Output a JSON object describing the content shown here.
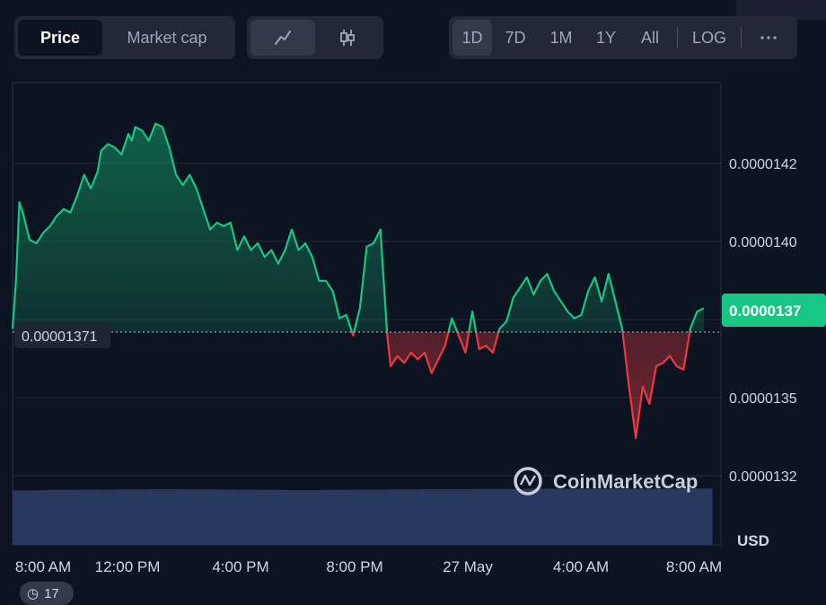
{
  "toolbar": {
    "metric_tabs": [
      {
        "label": "Price",
        "active": true
      },
      {
        "label": "Market cap",
        "active": false
      }
    ],
    "chart_type_icons": [
      "line-chart-icon",
      "candlestick-icon"
    ],
    "ranges": [
      "1D",
      "7D",
      "1M",
      "1Y",
      "All"
    ],
    "active_range": "1D",
    "log_label": "LOG",
    "more_icon": "more-horizontal-icon"
  },
  "colors": {
    "background": "#0d1421",
    "up": "#16c784",
    "down": "#ea3943",
    "volume": "#2b3a63",
    "badge": "#16c784"
  },
  "chart_data": {
    "type": "line",
    "y_tick_labels": [
      "0.0000142",
      "0.0000140",
      "0.0000137",
      "0.0000135",
      "0.0000132"
    ],
    "ylim": [
      1.315e-05,
      1.445e-05
    ],
    "x_tick_labels": [
      "8:00 AM",
      "12:00 PM",
      "4:00 PM",
      "8:00 PM",
      "27 May",
      "4:00 AM",
      "8:00 AM"
    ],
    "reference_price": 1.371e-05,
    "reference_label": "0.00001371",
    "current_price_label": "0.0000137",
    "currency_label": "USD",
    "watermark": "CoinMarketCap",
    "price": [
      [
        0.0,
        1.373e-05
      ],
      [
        0.1,
        1.387e-05
      ],
      [
        0.2,
        1.41e-05
      ],
      [
        0.3,
        1.407e-05
      ],
      [
        0.5,
        1.399e-05
      ],
      [
        0.7,
        1.398e-05
      ],
      [
        0.9,
        1.401e-05
      ],
      [
        1.1,
        1.403e-05
      ],
      [
        1.3,
        1.406e-05
      ],
      [
        1.5,
        1.408e-05
      ],
      [
        1.7,
        1.407e-05
      ],
      [
        1.9,
        1.412e-05
      ],
      [
        2.1,
        1.418e-05
      ],
      [
        2.3,
        1.414e-05
      ],
      [
        2.5,
        1.419e-05
      ],
      [
        2.6,
        1.425e-05
      ],
      [
        2.8,
        1.427e-05
      ],
      [
        3.0,
        1.426e-05
      ],
      [
        3.2,
        1.424e-05
      ],
      [
        3.4,
        1.43e-05
      ],
      [
        3.5,
        1.428e-05
      ],
      [
        3.6,
        1.432e-05
      ],
      [
        3.8,
        1.431e-05
      ],
      [
        4.0,
        1.428e-05
      ],
      [
        4.2,
        1.433e-05
      ],
      [
        4.4,
        1.432e-05
      ],
      [
        4.6,
        1.426e-05
      ],
      [
        4.8,
        1.418e-05
      ],
      [
        5.0,
        1.415e-05
      ],
      [
        5.2,
        1.418e-05
      ],
      [
        5.4,
        1.414e-05
      ],
      [
        5.6,
        1.408e-05
      ],
      [
        5.8,
        1.402e-05
      ],
      [
        6.0,
        1.404e-05
      ],
      [
        6.2,
        1.403e-05
      ],
      [
        6.4,
        1.404e-05
      ],
      [
        6.6,
        1.396e-05
      ],
      [
        6.8,
        1.4e-05
      ],
      [
        7.0,
        1.396e-05
      ],
      [
        7.2,
        1.398e-05
      ],
      [
        7.4,
        1.394e-05
      ],
      [
        7.6,
        1.396e-05
      ],
      [
        7.8,
        1.392e-05
      ],
      [
        8.0,
        1.396e-05
      ],
      [
        8.2,
        1.402e-05
      ],
      [
        8.4,
        1.396e-05
      ],
      [
        8.6,
        1.398e-05
      ],
      [
        8.8,
        1.394e-05
      ],
      [
        9.0,
        1.387e-05
      ],
      [
        9.2,
        1.387e-05
      ],
      [
        9.4,
        1.384e-05
      ],
      [
        9.6,
        1.376e-05
      ],
      [
        9.8,
        1.377e-05
      ],
      [
        10.0,
        1.371e-05
      ],
      [
        10.2,
        1.379e-05
      ],
      [
        10.4,
        1.397e-05
      ],
      [
        10.6,
        1.398e-05
      ],
      [
        10.8,
        1.402e-05
      ],
      [
        11.0,
        1.371e-05
      ],
      [
        11.1,
        1.362e-05
      ],
      [
        11.3,
        1.365e-05
      ],
      [
        11.5,
        1.363e-05
      ],
      [
        11.7,
        1.366e-05
      ],
      [
        11.9,
        1.364e-05
      ],
      [
        12.1,
        1.366e-05
      ],
      [
        12.3,
        1.36e-05
      ],
      [
        12.5,
        1.364e-05
      ],
      [
        12.7,
        1.368e-05
      ],
      [
        12.9,
        1.376e-05
      ],
      [
        13.1,
        1.371e-05
      ],
      [
        13.3,
        1.366e-05
      ],
      [
        13.5,
        1.378e-05
      ],
      [
        13.7,
        1.367e-05
      ],
      [
        13.9,
        1.368e-05
      ],
      [
        14.1,
        1.366e-05
      ],
      [
        14.3,
        1.373e-05
      ],
      [
        14.5,
        1.375e-05
      ],
      [
        14.7,
        1.382e-05
      ],
      [
        14.9,
        1.385e-05
      ],
      [
        15.1,
        1.388e-05
      ],
      [
        15.3,
        1.383e-05
      ],
      [
        15.5,
        1.387e-05
      ],
      [
        15.7,
        1.389e-05
      ],
      [
        15.9,
        1.384e-05
      ],
      [
        16.1,
        1.381e-05
      ],
      [
        16.3,
        1.378e-05
      ],
      [
        16.5,
        1.376e-05
      ],
      [
        16.7,
        1.377e-05
      ],
      [
        16.9,
        1.384e-05
      ],
      [
        17.1,
        1.388e-05
      ],
      [
        17.3,
        1.381e-05
      ],
      [
        17.5,
        1.389e-05
      ],
      [
        17.7,
        1.381e-05
      ],
      [
        17.9,
        1.373e-05
      ],
      [
        18.1,
        1.356e-05
      ],
      [
        18.3,
        1.341e-05
      ],
      [
        18.5,
        1.356e-05
      ],
      [
        18.7,
        1.351e-05
      ],
      [
        18.9,
        1.362e-05
      ],
      [
        19.1,
        1.363e-05
      ],
      [
        19.3,
        1.365e-05
      ],
      [
        19.5,
        1.362e-05
      ],
      [
        19.7,
        1.361e-05
      ],
      [
        19.9,
        1.373e-05
      ],
      [
        20.1,
        1.378e-05
      ],
      [
        20.3,
        1.379e-05
      ]
    ],
    "volume": [
      0.42,
      0.43,
      0.45,
      0.45,
      0.46,
      0.46,
      0.47,
      0.47,
      0.48,
      0.48,
      0.47,
      0.47,
      0.46,
      0.46,
      0.45,
      0.45,
      0.44,
      0.44,
      0.45,
      0.45,
      0.46,
      0.46,
      0.47,
      0.47,
      0.48,
      0.48,
      0.48,
      0.49,
      0.49,
      0.49,
      0.5,
      0.5,
      0.5,
      0.5,
      0.5,
      0.5,
      0.5,
      0.5,
      0.5,
      0.51,
      0.51
    ]
  },
  "footer": {
    "badge_text": "17"
  }
}
